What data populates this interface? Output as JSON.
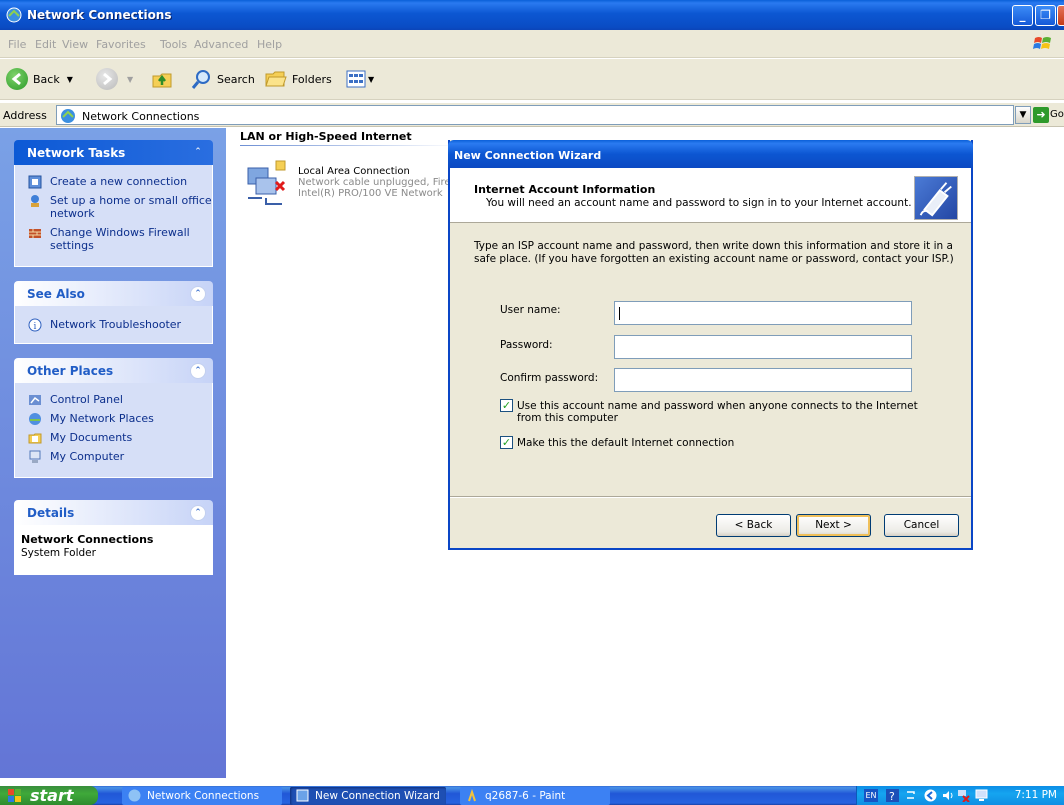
{
  "window": {
    "title": "Network Connections"
  },
  "menu": [
    "File",
    "Edit",
    "View",
    "Favorites",
    "Tools",
    "Advanced",
    "Help"
  ],
  "toolbar": {
    "back": "Back",
    "search": "Search",
    "folders": "Folders"
  },
  "address": {
    "label": "Address",
    "value": "Network Connections",
    "go": "Go"
  },
  "left_pane": {
    "network_tasks": {
      "title": "Network Tasks",
      "items": [
        "Create a new connection",
        "Set up a home or small office network",
        "Change Windows Firewall settings"
      ]
    },
    "see_also": {
      "title": "See Also",
      "items": [
        "Network Troubleshooter"
      ]
    },
    "other_places": {
      "title": "Other Places",
      "items": [
        "Control Panel",
        "My Network Places",
        "My Documents",
        "My Computer"
      ]
    },
    "details": {
      "title": "Details",
      "name": "Network Connections",
      "type": "System Folder"
    }
  },
  "content": {
    "group": "LAN or High-Speed Internet",
    "connection": {
      "name": "Local Area Connection",
      "status": "Network cable unplugged, Fire",
      "device": "Intel(R) PRO/100 VE Network"
    }
  },
  "wizard": {
    "title": "New Connection Wizard",
    "heading": "Internet Account Information",
    "subheading": "You will need an account name and password to sign in to your Internet account.",
    "intro": "Type an ISP account name and password, then write down this information and store it in a safe place. (If you have forgotten an existing account name or password, contact your ISP.)",
    "fields": {
      "username_label": "User name:",
      "username_value": "",
      "password_label": "Password:",
      "confirm_label": "Confirm password:"
    },
    "checkbox1": {
      "label": "Use this account  name and password when anyone connects to the Internet from this computer",
      "checked": true
    },
    "checkbox2": {
      "label": "Make this the default Internet connection",
      "checked": true
    },
    "buttons": {
      "back": "< Back",
      "next": "Next >",
      "cancel": "Cancel"
    }
  },
  "taskbar": {
    "start": "start",
    "tasks": [
      "Network Connections",
      "New Connection Wizard",
      "q2687-6 - Paint"
    ],
    "lang": "EN",
    "clock": "7:11 PM"
  }
}
